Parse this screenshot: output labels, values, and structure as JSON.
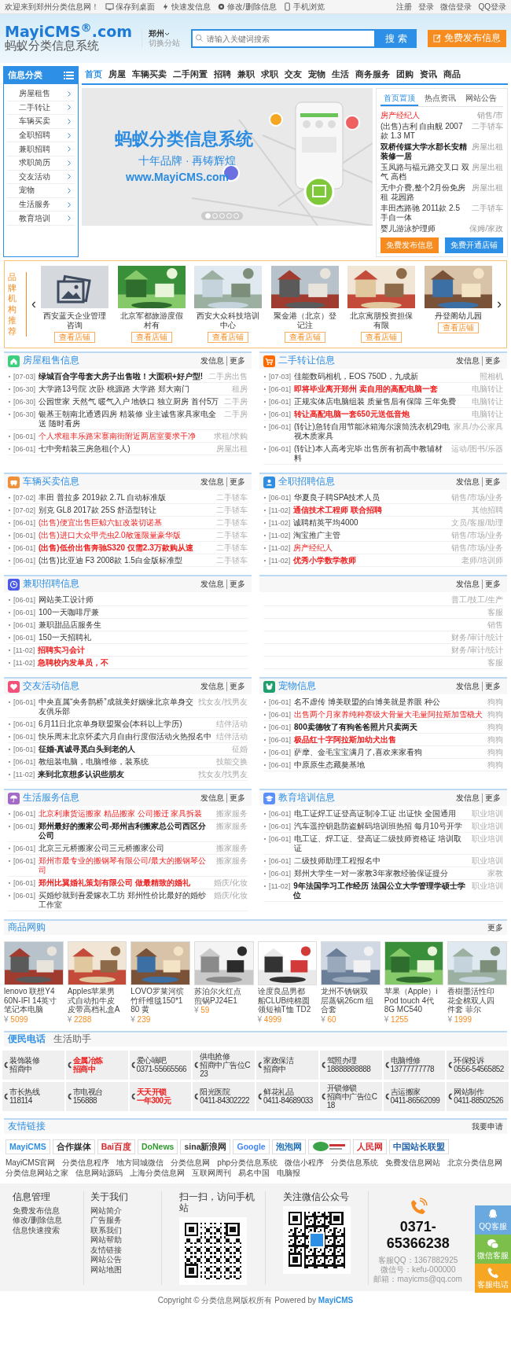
{
  "topbar": {
    "left": [
      {
        "text": "欢迎来到郑州分类信息网！"
      },
      {
        "text": "保存到桌面"
      },
      {
        "text": "快速发信息"
      },
      {
        "text": "修改/删除信息"
      },
      {
        "text": "手机浏览"
      }
    ],
    "right": [
      "注册",
      "登录",
      "微信登录",
      "QQ登录"
    ]
  },
  "header": {
    "logo": "MayiCMS$^{®}$.com",
    "logo_subtitle": "蚂蚁分类信息系统",
    "city": "郑州",
    "city_switch": "切换分站",
    "search": {
      "placeholder": "请输入关键词搜索",
      "button": "搜 索"
    },
    "post_button": "免费发布信息"
  },
  "sidebar": {
    "title": "信息分类",
    "items": [
      "房屋租售",
      "二手转让",
      "车辆买卖",
      "全职招聘",
      "兼职招聘",
      "求职简历",
      "交友活动",
      "宠物",
      "生活服务",
      "教育培训"
    ]
  },
  "nav": [
    {
      "label": "首页",
      "selected": true
    },
    {
      "label": "房屋",
      "selected": false
    },
    {
      "label": "车辆买卖",
      "selected": false
    },
    {
      "label": "二手闲置",
      "selected": false
    },
    {
      "label": "招聘",
      "selected": false
    },
    {
      "label": "兼职",
      "selected": false
    },
    {
      "label": "求职",
      "selected": false
    },
    {
      "label": "交友",
      "selected": false
    },
    {
      "label": "宠物",
      "selected": false
    },
    {
      "label": "生活",
      "selected": false
    },
    {
      "label": "商务服务",
      "selected": false
    },
    {
      "label": "团购",
      "selected": false
    },
    {
      "label": "资讯",
      "selected": false
    },
    {
      "label": "商品",
      "selected": false
    }
  ],
  "slider": {
    "headline": "蚂蚁分类信息系统",
    "tagline": "十年品牌 · 再铸辉煌",
    "url": "www.MayiCMS.com",
    "dots": [
      {
        "selected": true
      },
      {
        "selected": false
      },
      {
        "selected": false
      },
      {
        "selected": false
      },
      {
        "selected": false
      }
    ]
  },
  "notices": {
    "tabs": [
      {
        "label": "首页置顶",
        "selected": true
      },
      {
        "label": "热点资讯",
        "selected": false
      },
      {
        "label": "网站公告",
        "selected": false
      }
    ],
    "items": [
      {
        "title": "房产经纪人",
        "category": "销售/市",
        "kind": "red"
      },
      {
        "title": "(出售)吉利 自由舰 2007款 1.3 MT",
        "category": "二手轿车",
        "kind": "plain"
      },
      {
        "title": "双桥传媒大学水郡长安精装修一居",
        "category": "房屋出租",
        "kind": "bold"
      },
      {
        "title": "玉凤路与福元路交叉口 双气 高档",
        "category": "房屋出租",
        "kind": "plain"
      },
      {
        "title": "无中介费,整个2月份免房租 花园路",
        "category": "房屋出租",
        "kind": "plain"
      },
      {
        "title": "丰田杰路驰 2011款 2.5 手自一体",
        "category": "二手轿车",
        "kind": "plain"
      },
      {
        "title": "婴儿游泳护理师",
        "category": "保姆/家政",
        "kind": "plain"
      }
    ],
    "buttons": [
      "免费发布信息",
      "免费开通店铺"
    ]
  },
  "brands": {
    "title": "品牌机构推荐",
    "prev": "‹",
    "next": "›",
    "items": [
      {
        "name": "西安蓝天企业管理咨询",
        "button": "查看店铺",
        "kind": "placeholder"
      },
      {
        "name": "北京军都旅游度假村有",
        "button": "查看店铺",
        "kind": "picture"
      },
      {
        "name": "西安大众科技培训中心",
        "button": "查看店铺",
        "kind": "picture"
      },
      {
        "name": "聚金港（北京）登记注",
        "button": "查看店铺",
        "kind": "picture"
      },
      {
        "name": "北京寓朋投资担保有限",
        "button": "查看店铺",
        "kind": "picture"
      },
      {
        "name": "丹登阁幼儿园",
        "button": "查看店铺",
        "kind": "picture"
      }
    ]
  },
  "sections": [
    {
      "title": "房屋租售信息",
      "color": "#3ecf7e",
      "actions": [
        "发信息",
        "更多"
      ],
      "rows": [
        {
          "date": "[07-03]",
          "title": "绿城百合字母套大房子出售啦！大面积+好户型!",
          "category": "二手房出售",
          "kind": "bold"
        },
        {
          "date": "[06-30]",
          "title": "大学路13号院 次卧 桃源路 大学路 郑大南门",
          "category": "租房",
          "kind": "plain"
        },
        {
          "date": "[06-30]",
          "title": "公园世家 天然气 暖气入户 地铁口 独立厨房 首付5万",
          "category": "二手房",
          "kind": "plain"
        },
        {
          "date": "[06-30]",
          "title": "银基王朝南北通透四房 精装修 业主诚售家具家电全送 随时看房",
          "category": "二手房",
          "kind": "plain"
        },
        {
          "date": "[06-01]",
          "title": "个人求租丰乐路宋寨南街附近两居室要求干净",
          "category": "求租/求购",
          "kind": "red"
        },
        {
          "date": "[06-01]",
          "title": "七中旁精装三房急租(个人)",
          "category": "房屋出租",
          "kind": "plain"
        }
      ]
    },
    {
      "title": "二手转让信息",
      "color": "#ff6a00",
      "actions": [
        "发信息",
        "更多"
      ],
      "rows": [
        {
          "date": "[07-03]",
          "title": "佳能数码相机，EOS 750D，九成新",
          "category": "照相机",
          "kind": "plain"
        },
        {
          "date": "[06-01]",
          "title": "即将毕业离开郑州 卖自用的高配电脑一套",
          "category": "电脑转让",
          "kind": "red-bold"
        },
        {
          "date": "[06-01]",
          "title": "正规实体店电脑组装 质量售后有保障 三年免费",
          "category": "电脑转让",
          "kind": "plain"
        },
        {
          "date": "[06-01]",
          "title": "转让高配电脑一套650元送低音炮",
          "category": "电脑转让",
          "kind": "red-bold"
        },
        {
          "date": "[06-01]",
          "title": "(转让)急转自用节能冰箱海尔滚筒洗衣机29电视木质家具",
          "category": "家具/办公家具",
          "kind": "plain"
        },
        {
          "date": "[06-01]",
          "title": "(转让)本人高考完毕 出售所有初高中教辅材料",
          "category": "运动/图书/乐器",
          "kind": "plain"
        }
      ]
    },
    {
      "title": "车辆买卖信息",
      "color": "#f0903a",
      "actions": [
        "发信息",
        "更多"
      ],
      "rows": [
        {
          "date": "[07-02]",
          "title": "丰田 普拉多 2019款 2.7L 自动标准版",
          "category": "二手轿车",
          "kind": "plain"
        },
        {
          "date": "[07-02]",
          "title": "别克 GL8 2017款 25S 舒适型转让",
          "category": "二手轿车",
          "kind": "plain"
        },
        {
          "date": "[06-01]",
          "title": "(出售)便宜出售巨鲸六缸改装切诺基",
          "category": "二手轿车",
          "kind": "red"
        },
        {
          "date": "[06-01]",
          "title": "(出售)进口大众甲壳虫2.0敞篷限量豪华版",
          "category": "二手轿车",
          "kind": "red"
        },
        {
          "date": "[06-01]",
          "title": "(出售)低价出售奔驰S320 仅需2.3万款购从速",
          "category": "二手轿车",
          "kind": "red-bold"
        },
        {
          "date": "[06-01]",
          "title": "(出售)比亚迪 F3 2008款 1.5白金版标准型",
          "category": "二手轿车",
          "kind": "plain"
        }
      ]
    },
    {
      "title": "全职招聘信息",
      "color": "#2f8ee0",
      "actions": [
        "发信息",
        "更多"
      ],
      "rows": [
        {
          "date": "[06-01]",
          "title": "华夏良子聘SPA技术人员",
          "category": "销售/市场/业务",
          "kind": "plain"
        },
        {
          "date": "[11-02]",
          "title": "通信技术工程师 联合招聘",
          "category": "其他招聘",
          "kind": "red-bold"
        },
        {
          "date": "[11-02]",
          "title": "诚聘精英平均4000",
          "category": "文员/客服/助理",
          "kind": "plain"
        },
        {
          "date": "[11-02]",
          "title": "淘宝推广主管",
          "category": "销售/市场/业务",
          "kind": "plain"
        },
        {
          "date": "[11-02]",
          "title": "房产经纪人",
          "category": "销售/市场/业务",
          "kind": "red"
        },
        {
          "date": "[11-02]",
          "title": "优秀小学数学教师",
          "category": "老师/培训师",
          "kind": "red-bold"
        }
      ]
    },
    {
      "title": "兼职招聘信息",
      "color": "#4b5ae8",
      "actions": [
        "发信息",
        "更多"
      ],
      "rows": [
        {
          "date": "[06-01]",
          "title": "网站美工设计师",
          "kind": "plain"
        },
        {
          "date": "[06-01]",
          "title": "100一天咖啡厅兼",
          "kind": "plain"
        },
        {
          "date": "[06-01]",
          "title": "兼职甜品店服务生",
          "kind": "plain"
        },
        {
          "date": "[06-01]",
          "title": "150一天招聘礼",
          "kind": "plain"
        },
        {
          "date": "[11-02]",
          "title": "招聘实习会计",
          "kind": "red-bold"
        },
        {
          "date": "[11-02]",
          "title": "急聘校内发单员，不",
          "kind": "red-bold"
        }
      ]
    },
    {
      "actions": [
        "发信息",
        "更多"
      ],
      "rows": [
        {
          "category": "普工/技工/生产"
        },
        {
          "category": "客服"
        },
        {
          "category": "销售"
        },
        {
          "category": "财务/审计/统计"
        },
        {
          "category": "财务/审计/统计"
        },
        {
          "category": "客服"
        }
      ]
    },
    {
      "title": "交友活动信息",
      "color": "#f0527a",
      "actions": [
        "发信息",
        "更多"
      ],
      "rows": [
        {
          "date": "[06-01]",
          "title": "中央直属“央务鹊桥”成就美好姻缘北京单身交友俱乐部",
          "category": "找女友/找男友",
          "kind": "plain"
        },
        {
          "date": "[06-01]",
          "title": "6月11日北京单身联盟聚会(本科以上学历)",
          "category": "结伴活动",
          "kind": "plain"
        },
        {
          "date": "[06-01]",
          "title": "快乐周末北京怀柔六月自由行度假活动火热报名中",
          "category": "结伴活动",
          "kind": "plain"
        },
        {
          "date": "[06-01]",
          "title": "征婚-真诚寻觅白头到老的人",
          "category": "征婚",
          "kind": "bold"
        },
        {
          "date": "[06-01]",
          "title": "教组装电脑，电脑维修，装系统",
          "category": "技能交换",
          "kind": "plain"
        },
        {
          "date": "[11-02]",
          "title": "来到北京想多认识些朋友",
          "category": "找女友/找男友",
          "kind": "bold"
        }
      ]
    },
    {
      "title": "宠物信息",
      "color": "#1f9e6e",
      "actions": [
        "发信息",
        "更多"
      ],
      "rows": [
        {
          "date": "[06-01]",
          "title": "名不虚传 博美联盟的白博美就是养眼 种公",
          "category": "狗狗",
          "kind": "plain"
        },
        {
          "date": "[06-01]",
          "title": "出售两个月家养纯种赛级大骨量大毛量阿拉斯加雪橇犬",
          "category": "狗狗",
          "kind": "red"
        },
        {
          "date": "[06-01]",
          "title": "800卖德牧了有狗爸爸照片只卖两天",
          "category": "狗狗",
          "kind": "bold"
        },
        {
          "date": "[06-01]",
          "title": "极品红十字阿拉斯加幼犬出售",
          "category": "狗狗",
          "kind": "red-bold"
        },
        {
          "date": "[06-01]",
          "title": "萨摩、金毛宝宝满月了,喜欢来家看狗",
          "category": "狗狗",
          "kind": "plain"
        },
        {
          "date": "[06-01]",
          "title": "中原原生态藏獒基地",
          "category": "狗狗",
          "kind": "plain"
        }
      ]
    },
    {
      "title": "生活服务信息",
      "color": "#a46ac8",
      "actions": [
        "发信息",
        "更多"
      ],
      "rows": [
        {
          "date": "[06-01]",
          "title": "北京利康货运搬家 精品搬家 公司搬迁 家具拆装",
          "category": "搬家服务",
          "kind": "red"
        },
        {
          "date": "[06-01]",
          "title": "郑州最好的搬家公司-郑州吉利搬家总公司西区分公司",
          "category": "搬家服务",
          "kind": "bold"
        },
        {
          "date": "[06-01]",
          "title": "北京三元桥搬家公司三元桥搬家公司",
          "category": "搬家服务",
          "kind": "plain"
        },
        {
          "date": "[06-01]",
          "title": "郑州市最专业的搬钢琴有限公司/最大的搬钢琴公司",
          "category": "搬家服务",
          "kind": "red"
        },
        {
          "date": "[06-01]",
          "title": "郑州比翼婚礼策划有限公司 做最精致的婚礼",
          "category": "婚庆/化妆",
          "kind": "red-bold"
        },
        {
          "date": "[06-01]",
          "title": "买婚纱就到吾爱嫁衣工坊 郑州性价比最好的婚纱工作室",
          "category": "婚庆/化妆",
          "kind": "plain"
        }
      ]
    },
    {
      "title": "教育培训信息",
      "color": "#5b8ff9",
      "actions": [
        "发信息",
        "更多"
      ],
      "rows": [
        {
          "date": "[06-01]",
          "title": "电工证焊工证登高证制冷工证 出证快 全国通用",
          "category": "职业培训",
          "kind": "plain"
        },
        {
          "date": "[06-01]",
          "title": "汽车遥控钥匙防盗解码培训班热招 每月10号开学",
          "category": "职业培训",
          "kind": "plain"
        },
        {
          "date": "[06-01]",
          "title": "电工证、焊工证、登高证二级技师资格证 培训取证",
          "category": "职业培训",
          "kind": "plain"
        },
        {
          "date": "[06-01]",
          "title": "二级技师助理工程报名中",
          "category": "职业培训",
          "kind": "plain"
        },
        {
          "date": "[06-01]",
          "title": "郑州大学生一对一家教3年家教经验保证提分",
          "category": "家教",
          "kind": "plain"
        },
        {
          "date": "[11-02]",
          "title": "9年法国学习工作经历 法国公立大学管理学硕士学位",
          "category": "职业培训",
          "kind": "bold"
        }
      ]
    }
  ],
  "products": {
    "title": "商品网购",
    "more": "更多",
    "items": [
      {
        "name": "lenovo 联想Y460N-IFI 14英寸笔记本电脑",
        "currency": "¥",
        "price": "5099"
      },
      {
        "name": "Apples苹果男式自动扣牛皮皮带高档礼盒A",
        "currency": "¥",
        "price": "2288"
      },
      {
        "name": "LOVO罗莱河缤竹纤维毯150*180 黄",
        "currency": "¥",
        "price": "239"
      },
      {
        "name": "苏泊尔火红点煎锅PJ24E1",
        "currency": "¥",
        "price": "59"
      },
      {
        "name": "诠度良品男都船CLUB纯棉圆领短袖T恤 TD2",
        "currency": "¥",
        "price": "4999"
      },
      {
        "name": "龙州不锈钢双层蒸锅26cm 组合套",
        "currency": "¥",
        "price": "60"
      },
      {
        "name": "苹果（Apple）iPod touch 4代 8G MC540",
        "currency": "¥",
        "price": "1255"
      },
      {
        "name": "香樹墨活性印花全棉双人四件套 菲尔",
        "currency": "¥",
        "price": "1999"
      }
    ]
  },
  "phones": {
    "tabs": [
      {
        "label": "便民电话",
        "selected": true
      },
      {
        "label": "生活助手",
        "selected": false
      }
    ],
    "items": [
      {
        "name": "装饰装修",
        "number": "招商中",
        "kind": "plain"
      },
      {
        "name": "金属冶炼",
        "number": "招商中",
        "kind": "red"
      },
      {
        "name": "爱心嘀吧",
        "number": "0371-55665566",
        "kind": "plain"
      },
      {
        "name": "供电抢修",
        "number": "招商中广告位C23",
        "kind": "plain"
      },
      {
        "name": "家政保洁",
        "number": "招商中",
        "kind": "plain"
      },
      {
        "name": "驾照办理",
        "number": "18888888888",
        "kind": "plain"
      },
      {
        "name": "电脑维修",
        "number": "13777777778",
        "kind": "plain"
      },
      {
        "name": "环保投诉",
        "number": "0556-54565852",
        "kind": "plain"
      },
      {
        "name": "市长热线",
        "number": "118114",
        "kind": "plain"
      },
      {
        "name": "市电视台",
        "number": "156888",
        "kind": "plain"
      },
      {
        "name": "天天开锁",
        "number": "一年300元",
        "kind": "red"
      },
      {
        "name": "阳光医院",
        "number": "0411-84302222",
        "kind": "plain"
      },
      {
        "name": "鲜花礼品",
        "number": "0411-84689033",
        "kind": "plain"
      },
      {
        "name": "开锁修锁",
        "number": "招商中广告位C18",
        "kind": "plain"
      },
      {
        "name": "吉运搬家",
        "number": "0411-86562099",
        "kind": "plain"
      },
      {
        "name": "网站制作",
        "number": "0411-88502526",
        "kind": "plain"
      }
    ]
  },
  "links": {
    "title": "友情链接",
    "apply": "我要申请",
    "logos": [
      {
        "text": "MayiCMS",
        "kind": "text"
      },
      {
        "text": "合作媒体",
        "kind": "text"
      },
      {
        "text": "Bai百度",
        "kind": "text"
      },
      {
        "text": "DoNews",
        "kind": "text"
      },
      {
        "text": "sina新浪网",
        "kind": "text"
      },
      {
        "text": "Google",
        "kind": "text"
      },
      {
        "text": "泡泡网",
        "kind": "text"
      },
      {
        "kind": "graphic"
      },
      {
        "text": "人民网",
        "kind": "text"
      },
      {
        "text": "中国站长联盟",
        "kind": "text"
      }
    ],
    "texts": [
      "MayiCMS官网",
      "分类信息程序",
      "地方同城微信",
      "分类信息网",
      "php分类信息系统",
      "微信小程序",
      "分类信息系统",
      "免费发信息网站",
      "北京分类信息网",
      "分类信息网站之家",
      "信息网站源码",
      "上海分类信息网",
      "互联网周刊",
      "易名中国",
      "电脑报"
    ]
  },
  "footer": {
    "columns": [
      {
        "title": "信息管理",
        "links": [
          "免费发布信息",
          "修改/删除信息",
          "信息快速搜索"
        ]
      },
      {
        "title": "关于我们",
        "links": [
          "网站简介",
          "广告服务",
          "联系我们",
          "网站帮助",
          "友情链接",
          "网站公告",
          "网站地图"
        ]
      }
    ],
    "qr_codes": [
      {
        "title": "扫一扫，访问手机站"
      },
      {
        "title": "关注微信公众号"
      }
    ],
    "contact": {
      "phone": "0371-65366238",
      "lines": [
        "客服QQ：1367882925",
        "微信号：kefu-000000",
        "邮箱：mayicms@qq.com"
      ]
    },
    "copyright": "Copyright © 分类信息网版权所有 Powered by",
    "powered_link": "MayiCMS"
  },
  "side_buttons": [
    "QQ客服",
    "微信客服",
    "客服电话"
  ]
}
